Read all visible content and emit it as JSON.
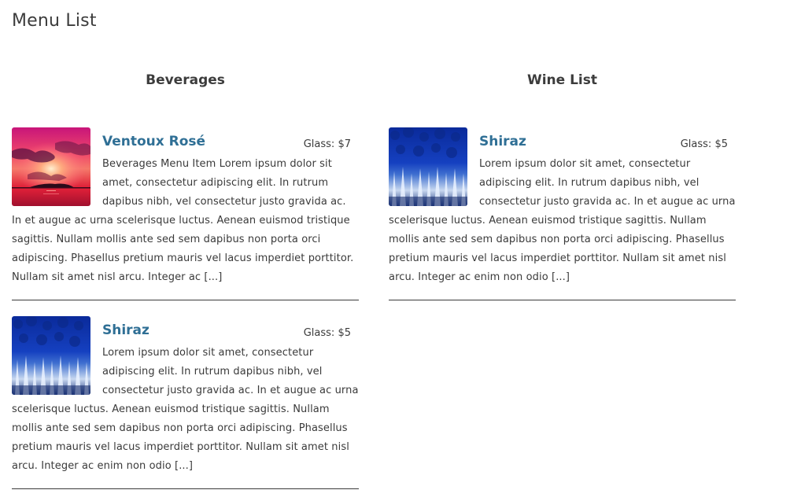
{
  "page": {
    "title": "Menu List"
  },
  "columns": [
    {
      "title": "Beverages",
      "items": [
        {
          "name": "Ventoux Rosé",
          "price": "Glass: $7",
          "description": "Beverages Menu Item Lorem ipsum dolor sit amet, consectetur adipiscing elit. In rutrum dapibus nibh, vel consectetur justo gravida ac. In et augue ac urna scelerisque luctus. Aenean euismod tristique sagittis. Nullam mollis ante sed sem dapibus non porta orci adipiscing. Phasellus pretium mauris vel lacus imperdiet porttitor. Nullam sit amet nisl arcu. Integer ac [...]",
          "image": "sunset-photo"
        },
        {
          "name": "Shiraz",
          "price": "Glass: $5",
          "description": "Lorem ipsum dolor sit amet, consectetur adipiscing elit. In rutrum dapibus nibh, vel consectetur justo gravida ac. In et augue ac urna scelerisque luctus. Aenean euismod tristique sagittis. Nullam mollis ante sed sem dapibus non porta orci adipiscing. Phasellus pretium mauris vel lacus imperdiet porttitor. Nullam sit amet nisl arcu. Integer ac enim non odio [...]",
          "image": "snowy-forest-photo"
        }
      ]
    },
    {
      "title": "Wine List",
      "items": [
        {
          "name": "Shiraz",
          "price": "Glass: $5",
          "description": "Lorem ipsum dolor sit amet, consectetur adipiscing elit. In rutrum dapibus nibh, vel consectetur justo gravida ac. In et augue ac urna scelerisque luctus. Aenean euismod tristique sagittis. Nullam mollis ante sed sem dapibus non porta orci adipiscing. Phasellus pretium mauris vel lacus imperdiet porttitor. Nullam sit amet nisl arcu. Integer ac enim non odio [...]",
          "image": "snowy-forest-photo"
        }
      ]
    }
  ],
  "colors": {
    "item_name": "#2f6f95",
    "text": "#3a3a3a",
    "divider": "#3a3a3a"
  }
}
